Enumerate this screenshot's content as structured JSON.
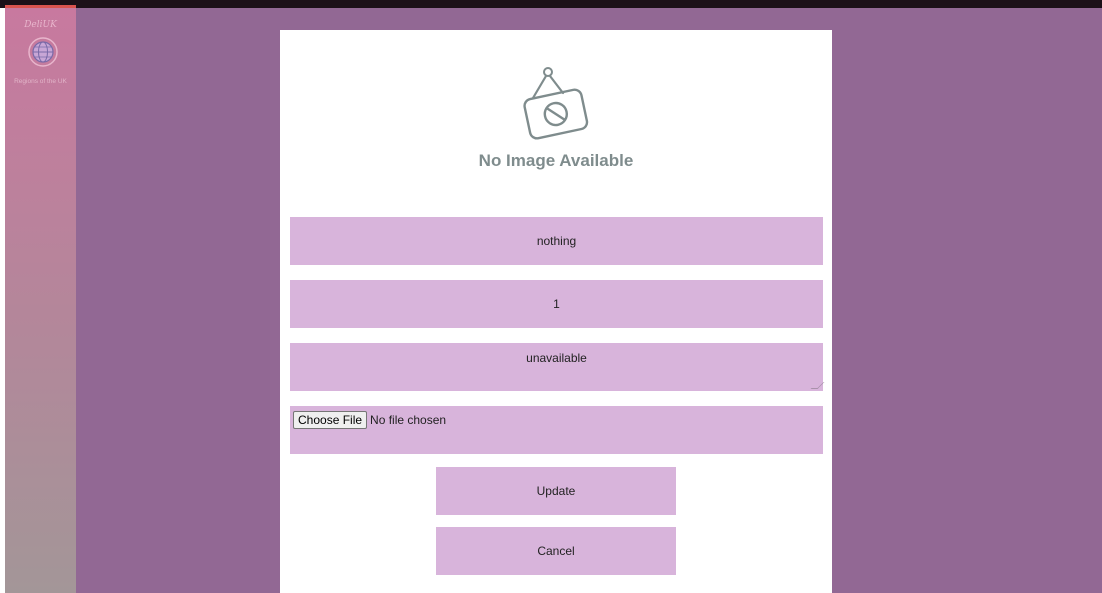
{
  "sidebar": {
    "logo_top_text": "DeliUK",
    "logo_bottom_text": "Regions of the UK"
  },
  "panel": {
    "no_image_text": "No Image Available",
    "fields": {
      "title_value": "nothing",
      "quantity_value": "1",
      "description_value": "unavailable",
      "file_button_label": "Choose File",
      "file_status": "No file chosen"
    },
    "buttons": {
      "update_label": "Update",
      "cancel_label": "Cancel"
    }
  },
  "colors": {
    "main_background": "#926894",
    "field_background": "#d8b4db",
    "placeholder_gray": "#7f8c8d",
    "sidebar_gradient_top": "#c8799f",
    "sidebar_gradient_bottom": "#a39698"
  },
  "icons": {
    "no_image": "no-image-icon",
    "logo_globe": "globe-icon"
  }
}
